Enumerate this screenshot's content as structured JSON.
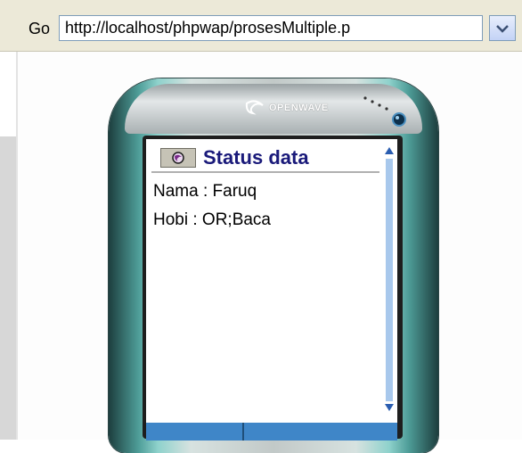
{
  "addressbar": {
    "go_label": "Go",
    "url": "http://localhost/phpwap/prosesMultiple.p"
  },
  "phone": {
    "brand": "OPENWAVE"
  },
  "screen": {
    "title": "Status data",
    "lines": [
      "Nama : Faruq",
      "Hobi : OR;Baca"
    ]
  },
  "colors": {
    "title_text": "#1a1a7a",
    "scroll_track": "#a8c8ec",
    "scroll_arrow": "#2a5db0",
    "phone_accent": "#4e9d98"
  }
}
